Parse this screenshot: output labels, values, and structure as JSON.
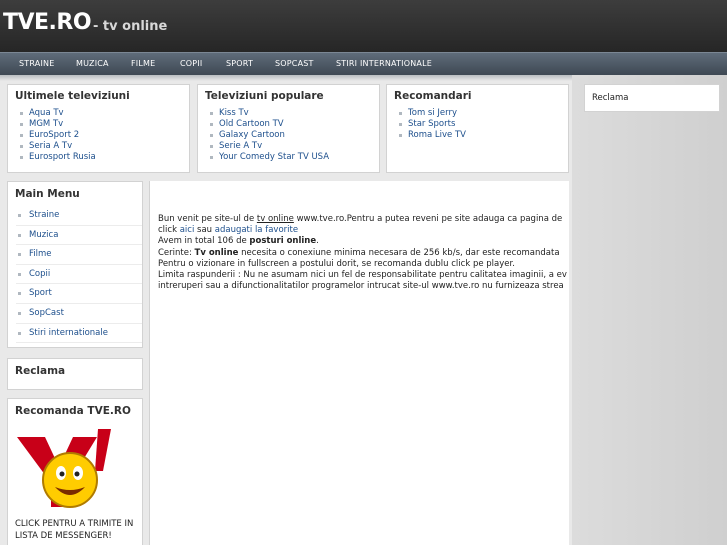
{
  "header": {
    "logo": "TVE.RO",
    "tagline": "- tv online"
  },
  "nav": [
    {
      "label": "STRAINE"
    },
    {
      "label": "MUZICA"
    },
    {
      "label": "FILME"
    },
    {
      "label": "COPII"
    },
    {
      "label": "SPORT"
    },
    {
      "label": "SOPCAST"
    },
    {
      "label": "STIRI INTERNATIONALE"
    }
  ],
  "latest": {
    "title": "Ultimele televiziuni",
    "items": [
      "Aqua Tv",
      "MGM Tv",
      "EuroSport 2",
      "Seria A Tv",
      "Eurosport Rusia"
    ]
  },
  "popular": {
    "title": "Televiziuni populare",
    "items": [
      "Kiss Tv",
      "Old Cartoon TV",
      "Galaxy Cartoon",
      "Serie A Tv",
      "Your Comedy Star TV USA"
    ]
  },
  "recommended": {
    "title": "Recomandari",
    "items": [
      "Tom si Jerry",
      "Star Sports",
      "Roma Live TV"
    ]
  },
  "right_ad": {
    "title": "Reclama"
  },
  "main_menu": {
    "title": "Main Menu",
    "items": [
      "Straine",
      "Muzica",
      "Filme",
      "Copii",
      "Sport",
      "SopCast",
      "Stiri internationale"
    ]
  },
  "left_ad": {
    "title": "Reclama"
  },
  "recommend_box": {
    "title": "Recomanda TVE.RO",
    "caption": "CLICK PENTRU A TRIMITE IN LISTA DE MESSENGER!"
  },
  "content": {
    "l1_a": "Bun venit pe site-ul de ",
    "l1_link": "tv online",
    "l1_b": " www.tve.ro.Pentru a putea reveni pe site adauga ca pagina de",
    "l2_a": "click ",
    "l2_link1": "aici",
    "l2_b": " sau ",
    "l2_link2": "adaugati la favorite",
    "l3_a": "Avem in total 106 de ",
    "l3_bold": "posturi online",
    "l3_b": ".",
    "l4_a": "Cerinte: ",
    "l4_bold": "Tv online",
    "l4_b": " necesita o conexiune minima necesara de 256 kb/s, dar este recomandata",
    "l5": "Pentru o vizionare in fullscreen a postului dorit, se recomanda dublu click pe player.",
    "l6": "Limita raspunderii : Nu ne asumam nici un fel de responsabilitate pentru calitatea imaginii, a ev",
    "l7": "intreruperi sau a difunctionalitatilor programelor intrucat site-ul www.tve.ro nu furnizeaza strea"
  }
}
